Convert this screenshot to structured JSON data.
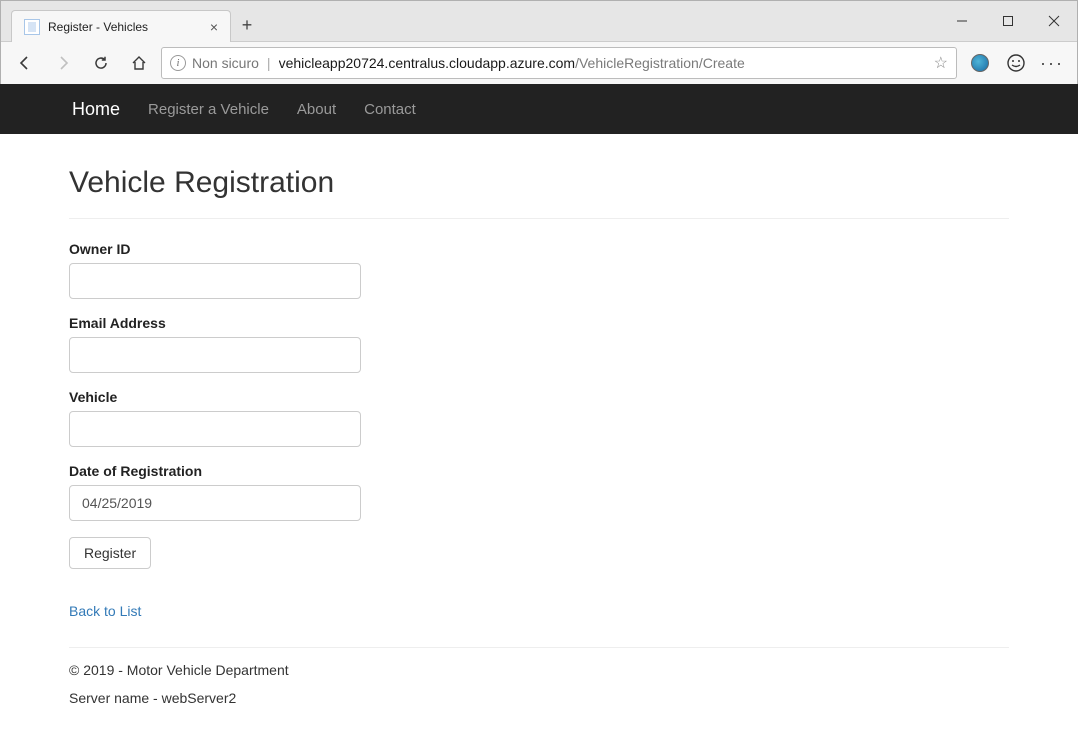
{
  "browser": {
    "tab_title": "Register - Vehicles",
    "security_label": "Non sicuro",
    "url_host": "vehicleapp20724.centralus.cloudapp.azure.com",
    "url_path": "/VehicleRegistration/Create"
  },
  "nav": {
    "home": "Home",
    "register": "Register a Vehicle",
    "about": "About",
    "contact": "Contact"
  },
  "page": {
    "title": "Vehicle Registration"
  },
  "form": {
    "owner_id": {
      "label": "Owner ID",
      "value": ""
    },
    "email": {
      "label": "Email Address",
      "value": ""
    },
    "vehicle": {
      "label": "Vehicle",
      "value": ""
    },
    "date": {
      "label": "Date of Registration",
      "value": "04/25/2019"
    },
    "submit_label": "Register",
    "back_link": "Back to List"
  },
  "footer": {
    "copyright": "© 2019 - Motor Vehicle Department",
    "server": "Server name - webServer2"
  }
}
